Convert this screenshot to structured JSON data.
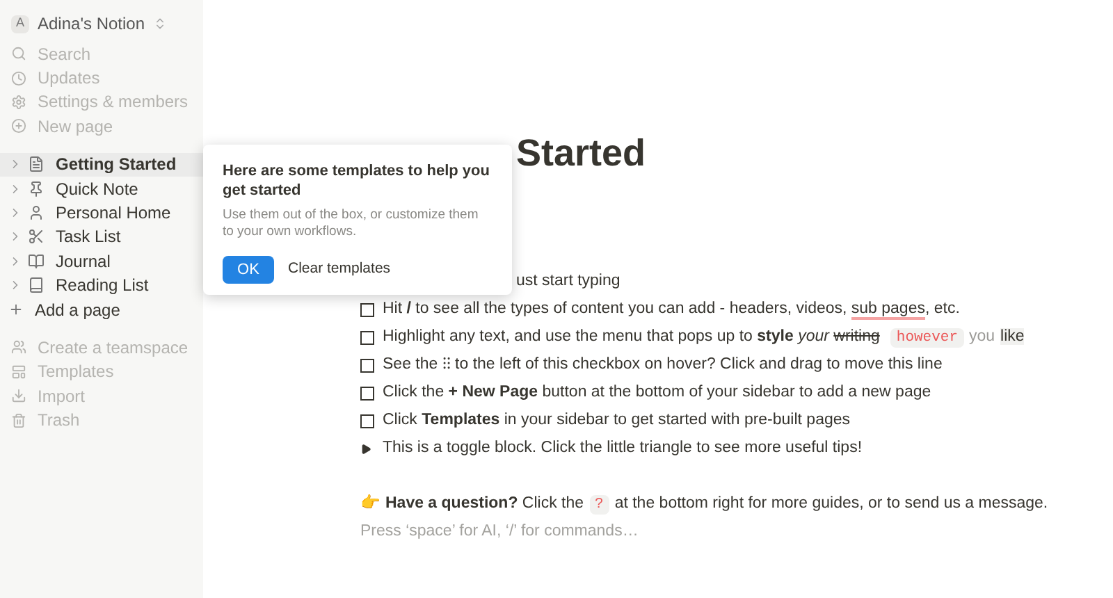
{
  "workspace": {
    "initial": "A",
    "name": "Adina's Notion"
  },
  "top_menu": [
    "Search",
    "Updates",
    "Settings & members",
    "New page"
  ],
  "pages": [
    {
      "label": "Getting Started",
      "selected": true
    },
    {
      "label": "Quick Note",
      "selected": false
    },
    {
      "label": "Personal Home",
      "selected": false
    },
    {
      "label": "Task List",
      "selected": false
    },
    {
      "label": "Journal",
      "selected": false
    },
    {
      "label": "Reading List",
      "selected": false
    }
  ],
  "add_page": "Add a page",
  "bottom_menu": [
    "Create a teamspace",
    "Templates",
    "Import",
    "Trash"
  ],
  "page": {
    "title": "Started",
    "blocks": [
      {
        "kind": "partial",
        "segments": [
          {
            "kind": "text",
            "text": "ust start typing"
          }
        ]
      },
      {
        "kind": "todo",
        "checked": false,
        "segments": [
          {
            "kind": "text",
            "text": "Hit **/** to see all the types of content you can add - headers, videos, "
          },
          {
            "kind": "underline",
            "text": "sub pages"
          },
          {
            "kind": "text",
            "text": ", etc."
          }
        ]
      },
      {
        "kind": "todo",
        "checked": false,
        "segments": [
          {
            "kind": "text",
            "text": "Highlight any text, and use the menu that pops up to **style** *your* "
          },
          {
            "kind": "strike",
            "text": "writing"
          },
          {
            "kind": "code",
            "text": "however"
          },
          {
            "kind": "faint",
            "text": "you"
          },
          {
            "kind": "highlight",
            "text": "like"
          }
        ]
      },
      {
        "kind": "todo",
        "checked": false,
        "segments": [
          {
            "kind": "text",
            "text": "See the ⁝⁝ to the left of this checkbox on hover? Click and drag to move this line"
          }
        ]
      },
      {
        "kind": "todo",
        "checked": false,
        "segments": [
          {
            "kind": "text",
            "text": "Click the **+ New Page** button at the bottom of your sidebar to add a new page"
          }
        ]
      },
      {
        "kind": "todo",
        "checked": false,
        "segments": [
          {
            "kind": "text",
            "text": "Click **Templates** in your sidebar to get started with pre-built pages"
          }
        ]
      },
      {
        "kind": "toggle",
        "expanded": false,
        "segments": [
          {
            "kind": "text",
            "text": "This is a toggle block. Click the little triangle to see more useful tips!"
          }
        ]
      },
      {
        "kind": "callout",
        "segments": [
          {
            "kind": "emoji",
            "text": "👉"
          },
          {
            "kind": "text",
            "text": "**Have a question?** Click the"
          },
          {
            "kind": "code",
            "text": "?"
          },
          {
            "kind": "text",
            "text": "at the bottom right for more guides, or to send us a message."
          }
        ]
      }
    ],
    "placeholder": "Press ‘space’ for AI, ‘/’ for commands…"
  },
  "popover": {
    "title": "Here are some templates to help you get started",
    "body": "Use them out of the box, or customize them to your own workflows.",
    "ok": "OK",
    "clear": "Clear templates"
  }
}
